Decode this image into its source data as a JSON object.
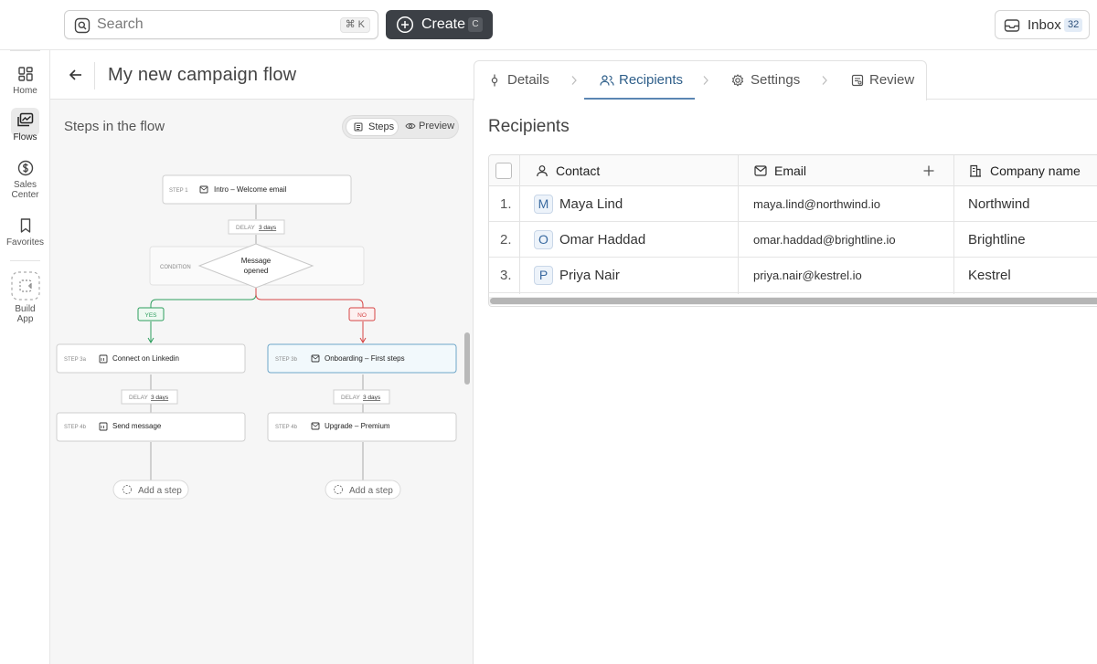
{
  "topbar": {
    "search_placeholder": "Search",
    "search_shortcut": "⌘ K",
    "create_label": "Create",
    "create_shortcut": "C",
    "inbox_label": "Inbox",
    "inbox_count": "32"
  },
  "rail": {
    "items": [
      {
        "label": "Home",
        "icon": "grid-icon"
      },
      {
        "label": "Flows",
        "icon": "flows-icon",
        "active": true
      },
      {
        "label": "Sales Center",
        "icon": "dollar-icon"
      },
      {
        "label": "Favorites",
        "icon": "bookmark-icon"
      },
      {
        "label": "Build App",
        "icon": "build-app-icon"
      }
    ]
  },
  "header": {
    "title": "My new campaign flow"
  },
  "flow": {
    "title": "Steps in the flow",
    "toggle": {
      "steps": "Steps",
      "preview": "Preview",
      "selected": "Steps"
    },
    "step1": {
      "tag": "STEP 1",
      "label": "Intro – Welcome email"
    },
    "delay1": {
      "label": "DELAY",
      "value": "3 days"
    },
    "condition": {
      "tag": "CONDITION",
      "label_line1": "Message",
      "label_line2": "opened"
    },
    "yes_label": "YES",
    "no_label": "NO",
    "step3a": {
      "tag": "STEP 3a",
      "label": "Connect on Linkedin"
    },
    "step3b": {
      "tag": "STEP 3b",
      "label": "Onboarding – First steps"
    },
    "delay_a": {
      "label": "DELAY",
      "value": "3 days"
    },
    "delay_b": {
      "label": "DELAY",
      "value": "3 days"
    },
    "step4a": {
      "tag": "STEP 4b",
      "label": "Send message"
    },
    "step4b": {
      "tag": "STEP 4b",
      "label": "Upgrade – Premium"
    },
    "add_step": "Add a step",
    "colors": {
      "yes": "#2e9e5e",
      "no": "#d64545",
      "selected": "#6fa6c9"
    }
  },
  "tabs": {
    "items": [
      "Details",
      "Recipients",
      "Settings",
      "Review"
    ],
    "active": "Recipients"
  },
  "recipients": {
    "title": "Recipients",
    "columns": [
      "Contact",
      "Email",
      "Company name"
    ],
    "rows": [
      {
        "index": "1.",
        "initial": "M",
        "name": "Maya Lind",
        "email": "maya.lind@northwind.io",
        "company": "Northwind"
      },
      {
        "index": "2.",
        "initial": "O",
        "name": "Omar Haddad",
        "email": "omar.haddad@brightline.io",
        "company": "Brightline"
      },
      {
        "index": "3.",
        "initial": "P",
        "name": "Priya Nair",
        "email": "priya.nair@kestrel.io",
        "company": "Kestrel"
      }
    ]
  }
}
